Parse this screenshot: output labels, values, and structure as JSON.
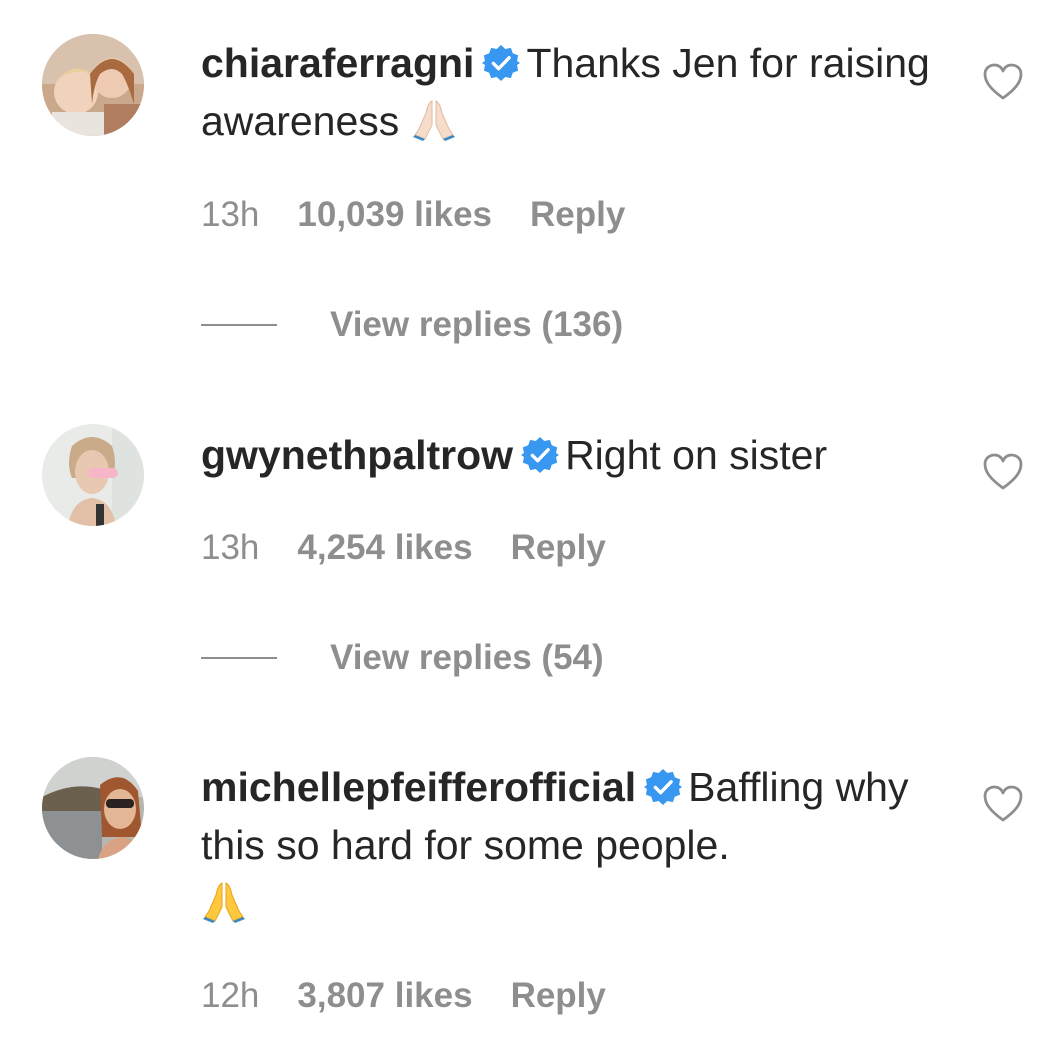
{
  "colors": {
    "text": "#262626",
    "muted": "#8e8e8e",
    "verified": "#3897f0",
    "background": "#ffffff"
  },
  "comments": [
    {
      "username": "chiaraferragni",
      "verified_icon": "verified-badge-icon",
      "text": "Thanks Jen for raising awareness",
      "emoji": "folded-hands-light-skin-emoji",
      "time": "13h",
      "likes": "10,039 likes",
      "reply": "Reply",
      "view_replies": "View replies (136)"
    },
    {
      "username": "gwynethpaltrow",
      "verified_icon": "verified-badge-icon",
      "text": "Right on sister",
      "time": "13h",
      "likes": "4,254 likes",
      "reply": "Reply",
      "view_replies": "View replies (54)"
    },
    {
      "username": "michellepfeifferofficial",
      "verified_icon": "verified-badge-icon",
      "text": "Baffling why this so hard for some people.",
      "emoji": "folded-hands-emoji",
      "time": "12h",
      "likes": "3,807 likes",
      "reply": "Reply"
    }
  ]
}
